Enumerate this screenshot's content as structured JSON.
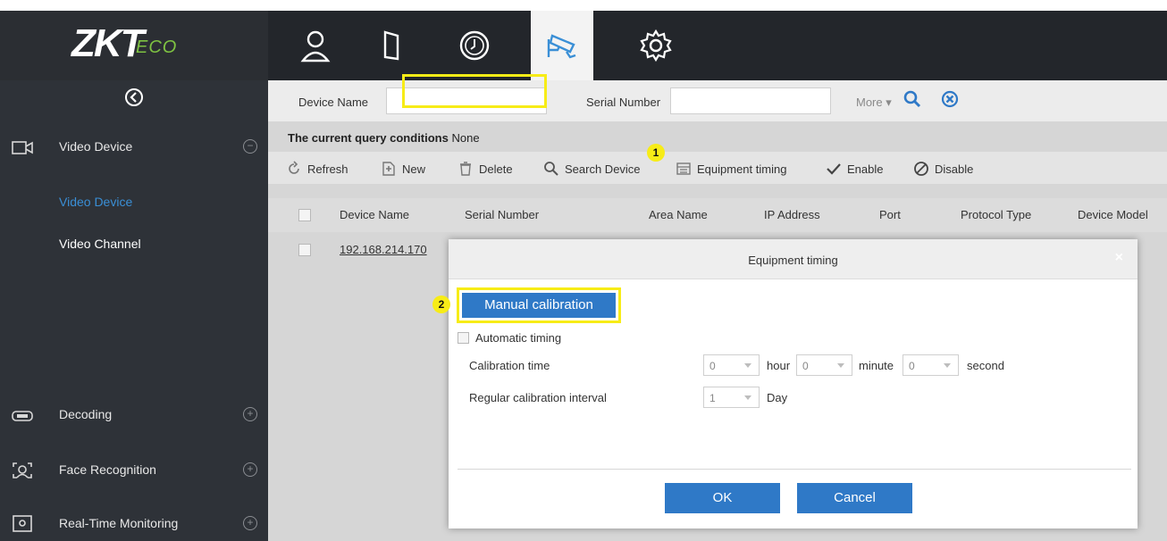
{
  "app": {
    "logo_main": "ZKT",
    "logo_suffix": "ECO"
  },
  "nav_icons": [
    "person-icon",
    "door-icon",
    "clock-icon",
    "cctv-icon",
    "gear-icon"
  ],
  "sidebar": {
    "groups": [
      {
        "label": "Video Device",
        "toggle": "−"
      },
      {
        "label": "Decoding",
        "toggle": "+"
      },
      {
        "label": "Face Recognition",
        "toggle": "+"
      },
      {
        "label": "Real-Time Monitoring",
        "toggle": "+"
      }
    ],
    "sub_items": [
      {
        "label": "Video Device"
      },
      {
        "label": "Video Channel"
      }
    ]
  },
  "search": {
    "device_name_label": "Device Name",
    "device_name_value": "",
    "serial_number_label": "Serial Number",
    "serial_number_value": "",
    "more_label": "More"
  },
  "query": {
    "label": "The current query conditions",
    "value": "None"
  },
  "toolbar": {
    "refresh": "Refresh",
    "new": "New",
    "delete": "Delete",
    "search_device": "Search Device",
    "equipment_timing": "Equipment timing",
    "enable": "Enable",
    "disable": "Disable"
  },
  "table": {
    "columns": [
      "Device Name",
      "Serial Number",
      "Area Name",
      "IP Address",
      "Port",
      "Protocol Type",
      "Device Model"
    ],
    "rows": [
      {
        "device_name": "192.168.214.170"
      }
    ]
  },
  "annotations": {
    "badge_1": "1",
    "badge_2": "2"
  },
  "dialog": {
    "title": "Equipment timing",
    "close": "×",
    "manual_calibration": "Manual calibration",
    "automatic_timing_label": "Automatic timing",
    "automatic_timing_checked": false,
    "calibration_time_label": "Calibration time",
    "hour_value": "0",
    "hour_unit": "hour",
    "minute_value": "0",
    "minute_unit": "minute",
    "second_value": "0",
    "second_unit": "second",
    "interval_label": "Regular calibration interval",
    "interval_value": "1",
    "interval_unit": "Day",
    "ok": "OK",
    "cancel": "Cancel"
  },
  "colors": {
    "accent": "#2f79c7",
    "highlight": "#f7ec17",
    "sidebar_bg": "#2e3238",
    "topbar_bg": "#23262b",
    "active_link": "#3a8fd6"
  }
}
